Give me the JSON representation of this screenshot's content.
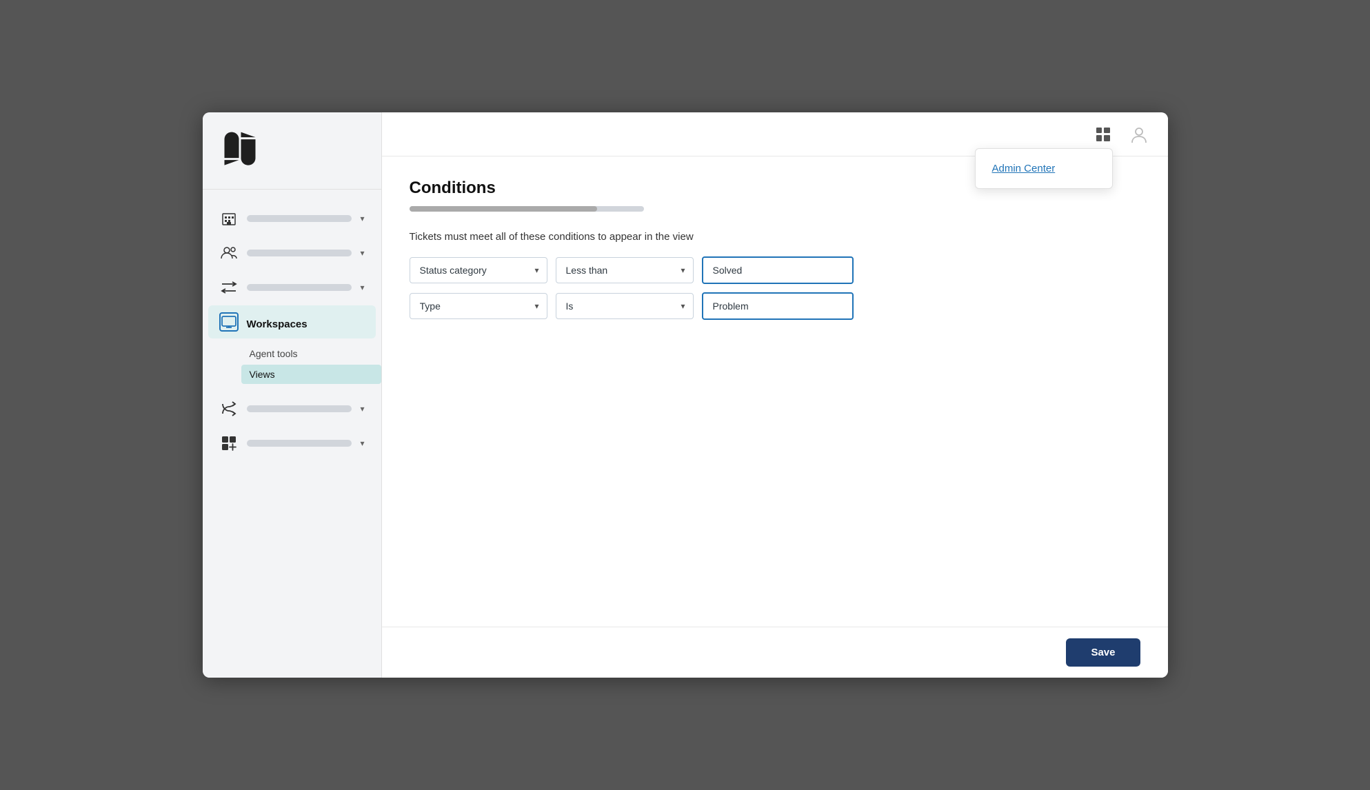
{
  "sidebar": {
    "nav_items": [
      {
        "id": "buildings",
        "icon": "🏢",
        "active": false
      },
      {
        "id": "people",
        "icon": "👥",
        "active": false
      },
      {
        "id": "arrows",
        "icon": "⇄",
        "active": false
      },
      {
        "id": "workspaces",
        "label": "Workspaces",
        "icon": "🖥",
        "active": true
      },
      {
        "id": "routing",
        "icon": "↩",
        "active": false
      },
      {
        "id": "addgrid",
        "icon": "⊞",
        "active": false
      }
    ],
    "sub_items": [
      {
        "id": "agent-tools",
        "label": "Agent tools",
        "active": false
      },
      {
        "id": "views",
        "label": "Views",
        "active": true
      }
    ]
  },
  "topbar": {
    "admin_center_label": "Admin Center"
  },
  "page": {
    "title": "Conditions",
    "description": "Tickets must meet all of these conditions to appear in the view",
    "conditions": [
      {
        "field": "Status category",
        "operator": "Less than",
        "value": "Solved"
      },
      {
        "field": "Type",
        "operator": "Is",
        "value": "Problem"
      }
    ]
  },
  "buttons": {
    "save": "Save"
  }
}
